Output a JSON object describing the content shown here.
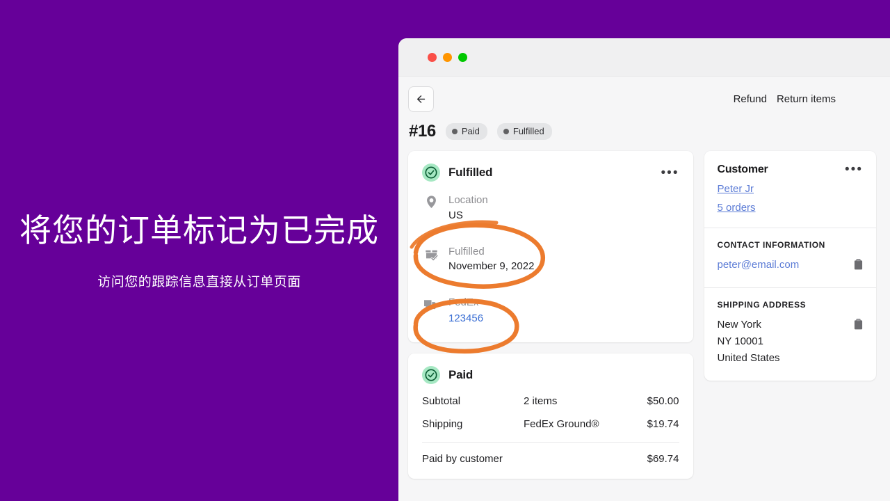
{
  "promo": {
    "headline": "将您的订单标记为已完成",
    "subtitle": "访问您的跟踪信息直接从订单页面",
    "background_color": "#660099",
    "text_color": "#ffffff"
  },
  "window": {
    "traffic_lights": [
      {
        "name": "close",
        "color": "#fa4f48"
      },
      {
        "name": "minimize",
        "color": "#ff9500"
      },
      {
        "name": "maximize",
        "color": "#00c800"
      }
    ]
  },
  "header": {
    "back_icon": "arrow-left-icon",
    "actions": [
      {
        "label": "Refund"
      },
      {
        "label": "Return items"
      }
    ],
    "order_id": "#16",
    "badges": [
      {
        "label": "Paid"
      },
      {
        "label": "Fulfilled"
      }
    ]
  },
  "fulfillment_card": {
    "title": "Fulfilled",
    "status_icon": "check-circle-icon",
    "menu_icon": "ellipsis-icon",
    "location": {
      "icon": "map-pin-icon",
      "label": "Location",
      "value": "US"
    },
    "fulfilled": {
      "icon": "package-check-icon",
      "label": "Fulfilled",
      "value": "November 9, 2022"
    },
    "carrier": {
      "icon": "truck-icon",
      "label": "FedEx",
      "tracking_number": "123456"
    }
  },
  "payment_card": {
    "title": "Paid",
    "status_icon": "check-circle-icon",
    "rows": [
      {
        "label": "Subtotal",
        "detail": "2 items",
        "amount": "$50.00"
      },
      {
        "label": "Shipping",
        "detail": "FedEx Ground®",
        "amount": "$19.74"
      }
    ],
    "total": {
      "label": "Paid by customer",
      "amount": "$69.74"
    }
  },
  "sidebar": {
    "customer": {
      "title": "Customer",
      "menu_icon": "ellipsis-icon",
      "name": "Peter  Jr",
      "orders": "5 orders"
    },
    "contact": {
      "caption": "CONTACT INFORMATION",
      "email": "peter@email.com",
      "copy_icon": "clipboard-icon"
    },
    "shipping": {
      "caption": "SHIPPING ADDRESS",
      "lines": [
        "New York",
        "NY 10001",
        "United States"
      ],
      "copy_icon": "clipboard-icon"
    }
  },
  "annotations": {
    "color": "#ec7b2e",
    "circles": [
      {
        "name": "fulfilled-date-highlight"
      },
      {
        "name": "tracking-number-highlight"
      }
    ]
  }
}
